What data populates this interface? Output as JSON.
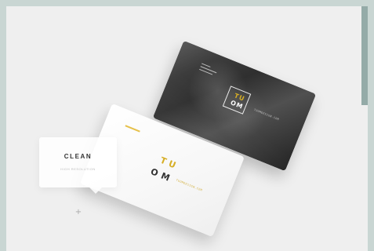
{
  "overlay": {
    "title": "CLEAN",
    "subtitle": "HIGH RESOLUTION"
  },
  "brand": {
    "top_letters": "TU",
    "bottom_letters": "OM",
    "url": "TUOMDESIGN.COM"
  },
  "marker": "+"
}
